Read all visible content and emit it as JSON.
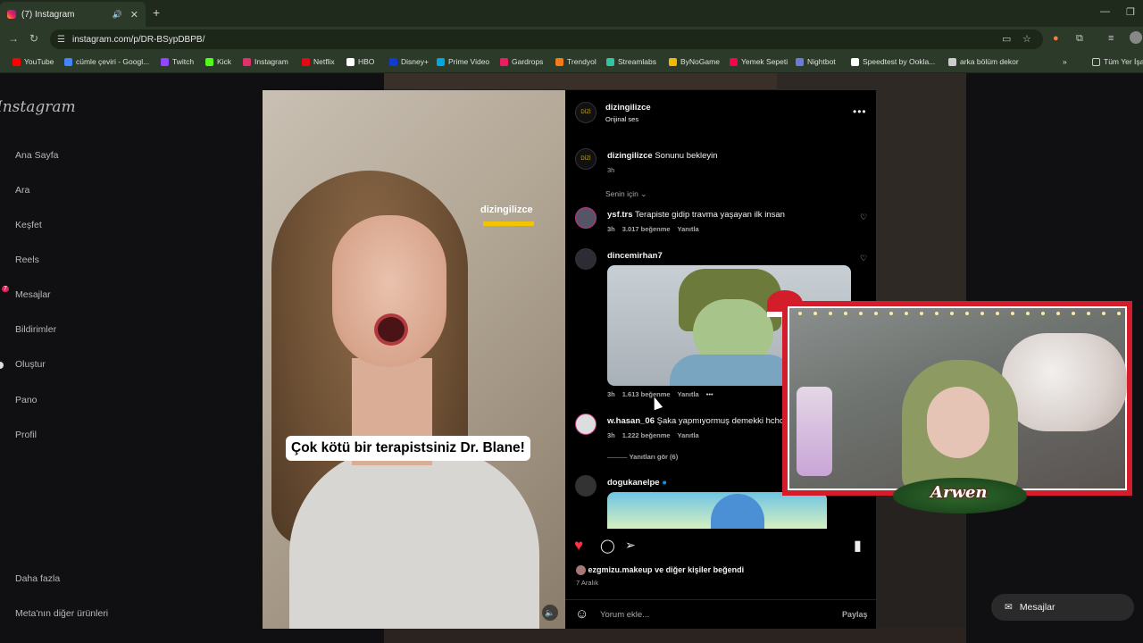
{
  "browser": {
    "tab_title": "(7) Instagram",
    "url": "instagram.com/p/DR-BSypDBPB/",
    "bookmarks": [
      {
        "label": "YouTube",
        "color": "#ff0000"
      },
      {
        "label": "cümle çeviri - Googl...",
        "color": "#4285f4"
      },
      {
        "label": "Twitch",
        "color": "#9146ff"
      },
      {
        "label": "Kick",
        "color": "#53fc18"
      },
      {
        "label": "Instagram",
        "color": "#e1306c"
      },
      {
        "label": "Netflix",
        "color": "#e50914"
      },
      {
        "label": "HBO",
        "color": "#ffffff"
      },
      {
        "label": "Disney+",
        "color": "#113ccf"
      },
      {
        "label": "Prime Video",
        "color": "#00a8e1"
      },
      {
        "label": "Gardrops",
        "color": "#e91e63"
      },
      {
        "label": "Trendyol",
        "color": "#f27a1a"
      },
      {
        "label": "Streamlabs",
        "color": "#31c3a2"
      },
      {
        "label": "ByNoGame",
        "color": "#f5b800"
      },
      {
        "label": "Yemek Sepeti",
        "color": "#fa0050"
      },
      {
        "label": "Nightbot",
        "color": "#6c7ae0"
      },
      {
        "label": "Speedtest by Ookla...",
        "color": "#ffffff"
      },
      {
        "label": "arka bölüm dekor",
        "color": "#cccccc"
      }
    ],
    "bookmarks_overflow": "Tüm Yer İşa"
  },
  "instagram": {
    "logo": "Instagram",
    "nav": [
      {
        "label": "Ana Sayfa"
      },
      {
        "label": "Ara"
      },
      {
        "label": "Keşfet"
      },
      {
        "label": "Reels"
      },
      {
        "label": "Mesajlar"
      },
      {
        "label": "Bildirimler"
      },
      {
        "label": "Oluştur"
      },
      {
        "label": "Pano"
      },
      {
        "label": "Profil"
      }
    ],
    "messages_badge": "7",
    "more": "Daha fazla",
    "meta_products": "Meta'nın diğer ürünleri",
    "messages_pill": "Mesajlar"
  },
  "post": {
    "author": "dizingilizce",
    "audio": "Orijinal ses",
    "watermark": "dizingilizce",
    "subtitle": "Çok kötü bir terapistsiniz Dr. Blane!",
    "caption_user": "dizingilizce",
    "caption_text": "Sonunu bekleyin",
    "caption_time": "3h",
    "sort_label": "Senin için",
    "comments": [
      {
        "user": "ysf.trs",
        "text": "Terapiste gidip travma yaşayan ilk insan",
        "time": "3h",
        "likes": "3.017 beğenme",
        "reply": "Yanıtla"
      },
      {
        "user": "dincemirhan7",
        "text": "",
        "time": "3h",
        "likes": "1.613 beğenme",
        "reply": "Yanıtla"
      },
      {
        "user": "w.hasan_06",
        "text": "Şaka yapmıyormuş demekki hchc",
        "time": "3h",
        "likes": "1.222 beğenme",
        "reply": "Yanıtla"
      },
      {
        "user": "dogukanelpe",
        "text": "",
        "time": "",
        "likes": "",
        "reply": ""
      }
    ],
    "view_replies": "Yanıtları gör (6)",
    "liked_by_user": "ezgmizu.makeup",
    "liked_by_rest": "ve diğer kişiler beğendi",
    "date": "7 Aralık",
    "comment_placeholder": "Yorum ekle...",
    "share_button": "Paylaş"
  },
  "overlay": {
    "streamer_name": "Arwen"
  },
  "colors": {
    "like_red": "#ff3040",
    "verified_blue": "#0095f6",
    "frame_red": "#d31d2a"
  }
}
